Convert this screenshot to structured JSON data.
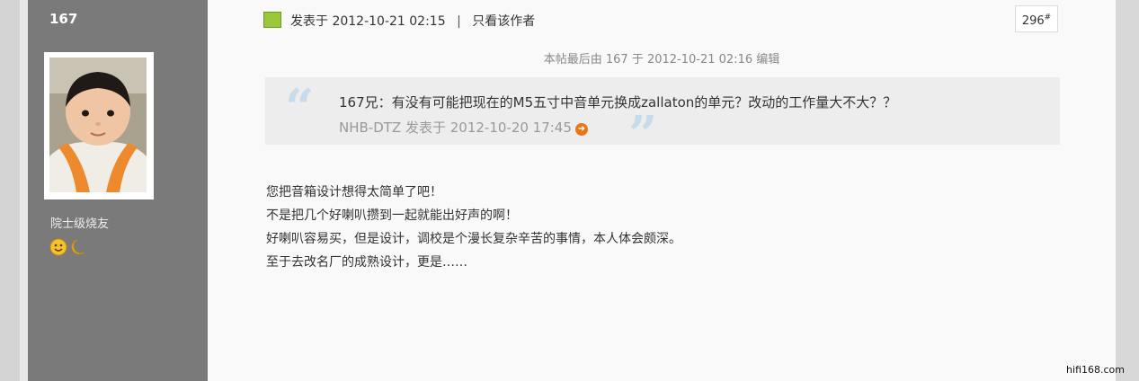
{
  "author": {
    "username": "167",
    "rank": "院士级烧友",
    "avatar_icon": "child-portrait-avatar",
    "medals_icon": "smiley-moon-medals"
  },
  "post": {
    "icon": "post-user-icon",
    "posted_label": "发表于 2012-10-21 02:15",
    "separator": "|",
    "author_only_link": "只看该作者",
    "floor_number": "296",
    "floor_mark": "#",
    "edit_note": "本帖最后由 167 于 2012-10-21 02:16 编辑"
  },
  "quote": {
    "text": "167兄：有没有可能把现在的M5五寸中音单元换成zallaton的单元？改动的工作量大不大？？",
    "attribution": "NHB-DTZ 发表于 2012-10-20 17:45",
    "back_icon": "jump-to-post-icon",
    "open_mark": "“",
    "close_mark": "”"
  },
  "body_lines": [
    "您把音箱设计想得太简单了吧！",
    "不是把几个好喇叭攒到一起就能出好声的啊！",
    "好喇叭容易买，但是设计，调校是个漫长复杂辛苦的事情，本人体会颇深。",
    "至于去改名厂的成熟设计，更是……"
  ],
  "watermark": "hifi168.com",
  "colors": {
    "sidebar_bg": "#7a7a7a",
    "content_bg": "#f9f9f9",
    "quote_bg": "#ededed",
    "quote_mark": "#c7dcea",
    "icon_green": "#9bc83a",
    "back_icon_orange": "#e8771b"
  }
}
